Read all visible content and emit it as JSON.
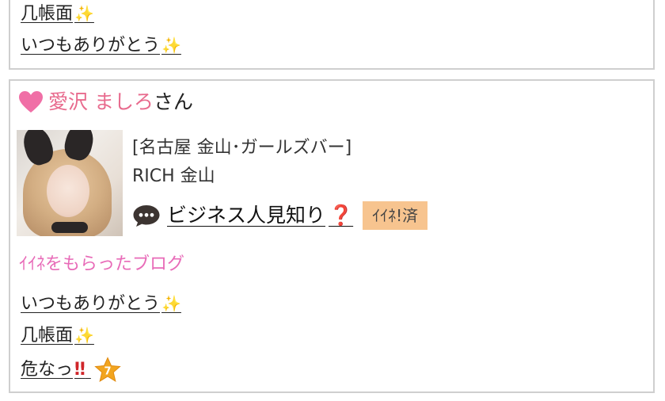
{
  "top_card": {
    "links": [
      {
        "text": "几帳面",
        "icon": "sparkles-icon"
      },
      {
        "text": "いつもありがとう",
        "icon": "sparkles-icon"
      }
    ]
  },
  "cast_card": {
    "name": "愛沢 ましろ",
    "honorific": "さん",
    "shop_area": "[名古屋 金山･ガールズバー]",
    "shop_name": "RICH 金山",
    "comment": "ビジネス人見知り",
    "comment_icon": "question-mark-icon",
    "like_badge": "ｲｲﾈ!済",
    "section_title": "ｲｲﾈをもらったブログ",
    "blog_links": [
      {
        "text": "いつもありがとう",
        "icon": "sparkles-icon"
      },
      {
        "text": "几帳面",
        "icon": "sparkles-icon"
      },
      {
        "text": "危なっ",
        "icon": "double-exclamation-icon"
      }
    ],
    "star_badge_text": "7",
    "colors": {
      "name": "#e86b8e",
      "heart": "#f06fa6",
      "section_title": "#e86bb8",
      "badge_bg": "#f7c48f",
      "sparkle": "#f2c94c",
      "alert": "#d0262a"
    }
  }
}
